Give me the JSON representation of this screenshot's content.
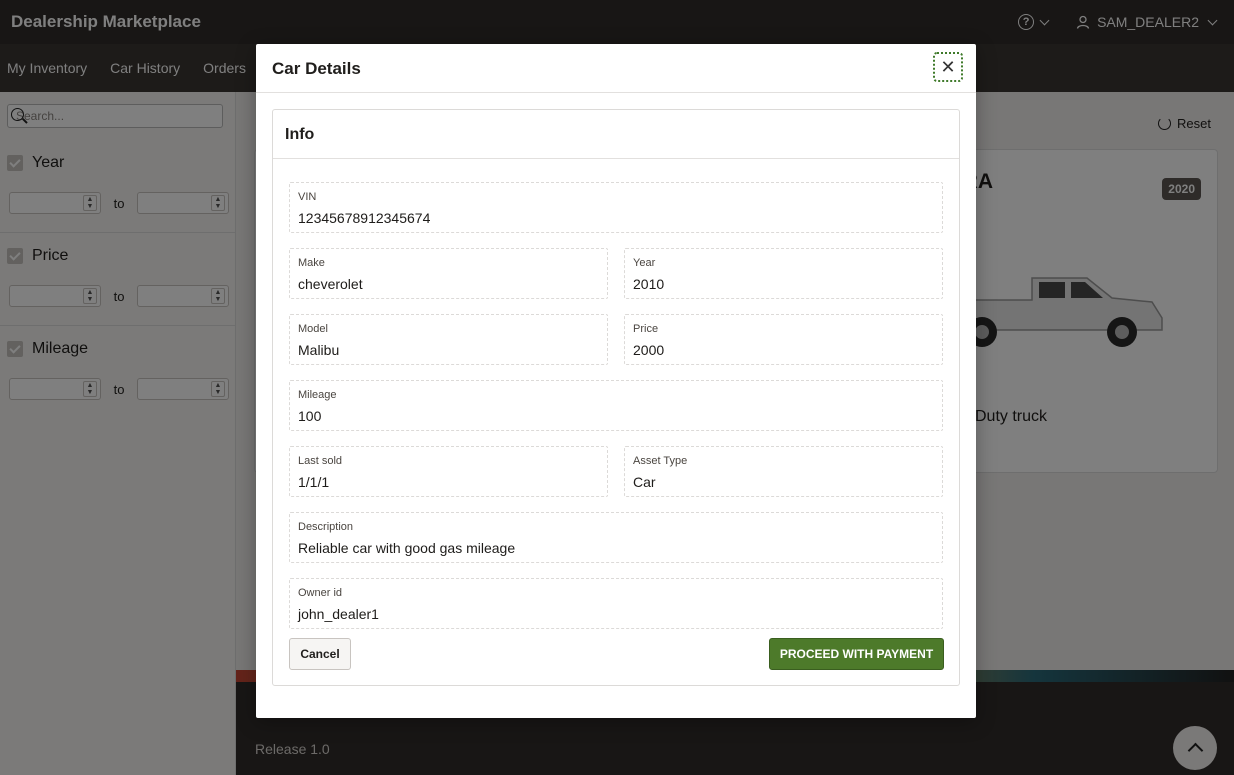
{
  "header": {
    "app_title": "Dealership Marketplace",
    "help_icon": "help-icon",
    "user_name": "SAM_DEALER2"
  },
  "nav": {
    "items": [
      "My Inventory",
      "Car History",
      "Orders"
    ]
  },
  "sidebar": {
    "search_placeholder": "Search...",
    "facets": [
      {
        "label": "Year",
        "to": "to"
      },
      {
        "label": "Price",
        "to": "to"
      },
      {
        "label": "Mileage",
        "to": "to"
      }
    ]
  },
  "main": {
    "reset_label": "Reset",
    "card": {
      "title_partial": "ORA",
      "year_badge": "2020",
      "description_partial": "Duty truck"
    }
  },
  "footer": {
    "release": "Release 1.0"
  },
  "modal": {
    "title": "Car Details",
    "region_title": "Info",
    "fields": {
      "vin": {
        "label": "VIN",
        "value": "12345678912345674"
      },
      "make": {
        "label": "Make",
        "value": "cheverolet"
      },
      "year": {
        "label": "Year",
        "value": "2010"
      },
      "model": {
        "label": "Model",
        "value": "Malibu"
      },
      "price": {
        "label": "Price",
        "value": "2000"
      },
      "mileage": {
        "label": "Mileage",
        "value": "100"
      },
      "last_sold": {
        "label": "Last sold",
        "value": "1/1/1"
      },
      "asset_type": {
        "label": "Asset Type",
        "value": "Car"
      },
      "description": {
        "label": "Description",
        "value": "Reliable car with good gas mileage"
      },
      "owner_id": {
        "label": "Owner id",
        "value": "john_dealer1"
      }
    },
    "cancel_label": "Cancel",
    "proceed_label": "PROCEED WITH PAYMENT"
  },
  "colors": {
    "header_bg": "#312d2a",
    "primary_button": "#4d7a2a",
    "overlay": "rgba(0,0,0,0.5)"
  }
}
